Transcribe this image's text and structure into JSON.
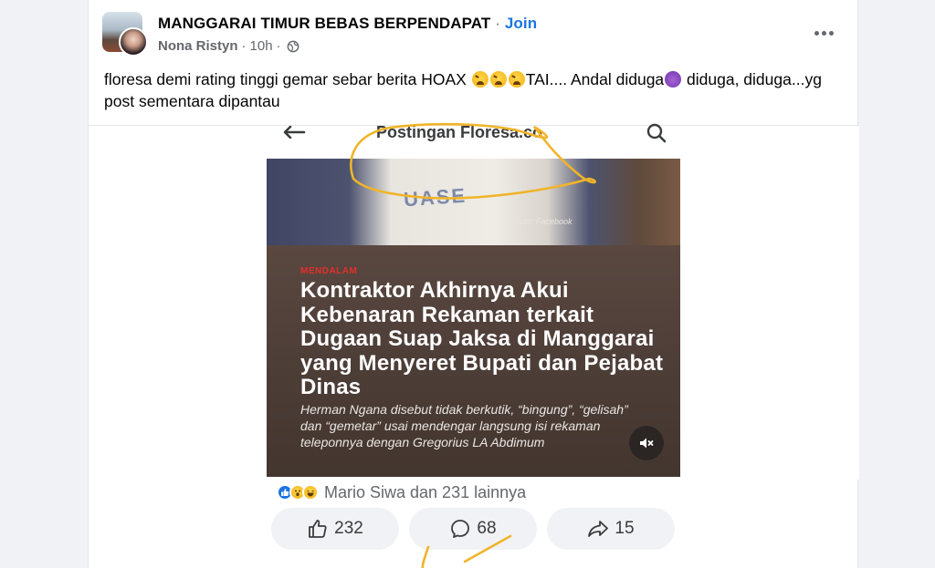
{
  "post": {
    "group_name": "MANGGARAI TIMUR BEBAS BERPENDAPAT",
    "separator": "·",
    "join_label": "Join",
    "author": "Nona Ristyn",
    "time": "10h",
    "text_part1": "floresa demi rating tinggi gemar sebar berita HOAX ",
    "text_part2": "TAI.... Andal diduga",
    "text_part3": " diduga, diduga...yg post sementara dipantau",
    "icons": {
      "more": "more-dots-icon",
      "audience": "globe-icon",
      "emoji_1": "tired-face-emoji",
      "emoji_2": "devil-emoji"
    }
  },
  "shared_screenshot": {
    "app_bar_title": "Postingan Floresa.co",
    "photo_shirt_text": "UASE",
    "photo_credit": "Foto: Facebook",
    "kicker": "MENDALAM",
    "headline": "Kontraktor Akhirnya Akui Kebenaran Rekaman terkait Dugaan Suap Jaksa di Manggarai yang Menyeret Bupati dan Pejabat Dinas",
    "lede": "Herman Ngana disebut tidak berkutik, “bingung”, “gelisah” dan “gemetar” usai mendengar langsung isi rekaman teleponnya dengan Gregorius LA Abdimum",
    "kicker_color": "#e2302a"
  },
  "reactions": {
    "summary": "Mario Siwa dan 231 lainnya",
    "types": [
      "like",
      "wow",
      "haha"
    ]
  },
  "actions": {
    "likes": "232",
    "comments": "68",
    "shares": "15"
  },
  "colors": {
    "accent": "#1b74e4",
    "annotation": "#f0b429"
  }
}
